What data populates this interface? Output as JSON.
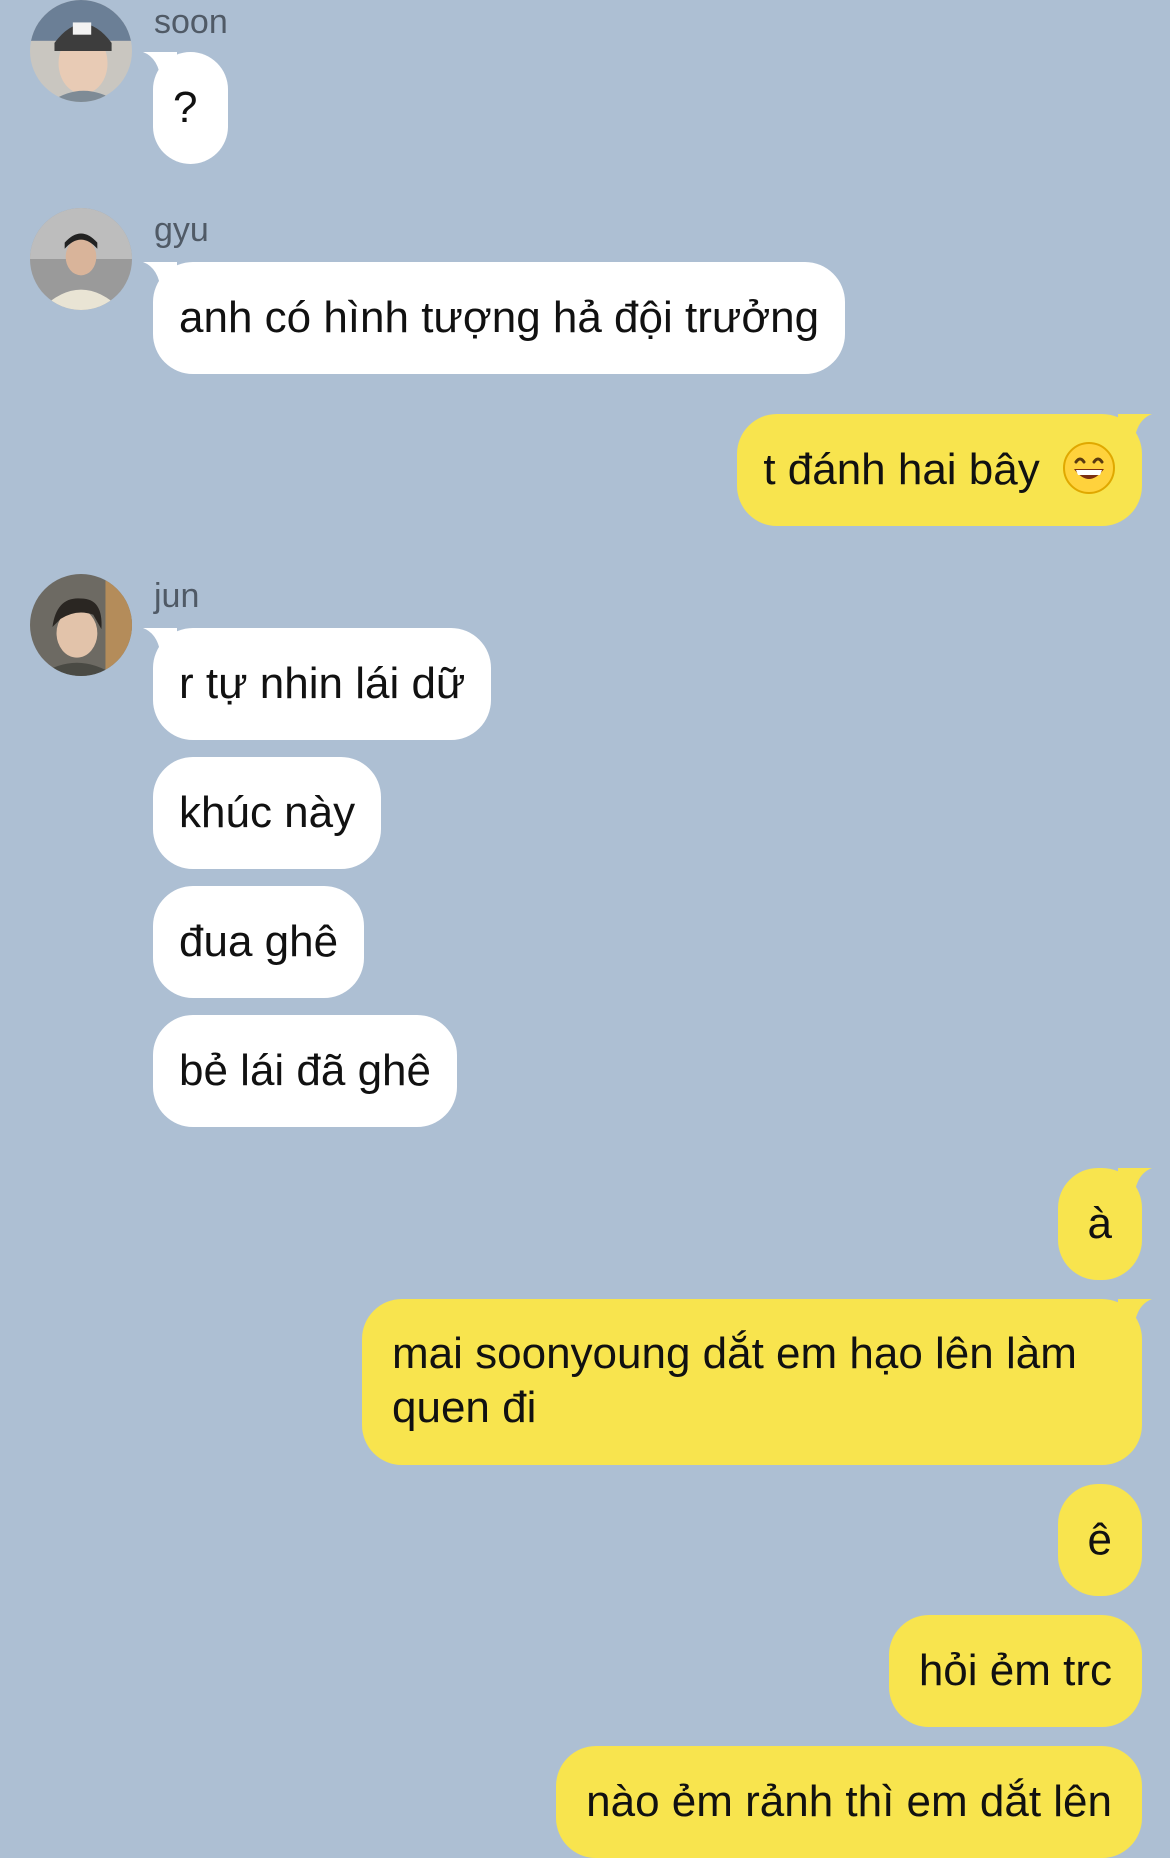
{
  "chat": {
    "users": {
      "soon": {
        "name": "soon"
      },
      "gyu": {
        "name": "gyu"
      },
      "jun": {
        "name": "jun"
      }
    },
    "messages": {
      "m1": "?",
      "m2": "anh có hình tượng hả đội trưởng",
      "m3": "t đánh hai bây",
      "m4": "r tự nhin lái dữ",
      "m5": "khúc này",
      "m6": "đua ghê",
      "m7": "bẻ lái đã ghê",
      "m8": "à",
      "m9": "mai soonyoung dắt em hạo lên làm quen đi",
      "m10": "ê",
      "m11": "hỏi ẻm trc",
      "m12": "nào ẻm rảnh thì em dắt lên"
    },
    "emoji": {
      "m3": "grinning-face-with-smiling-eyes"
    }
  },
  "colors": {
    "background": "#adbfd3",
    "incoming_bubble": "#ffffff",
    "outgoing_bubble": "#f8e44e"
  }
}
